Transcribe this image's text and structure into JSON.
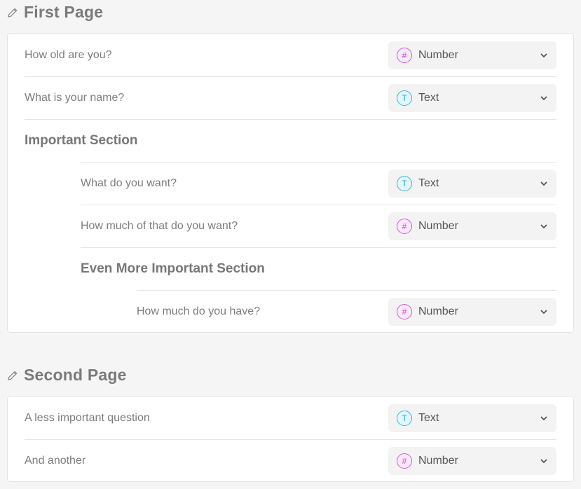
{
  "pages": [
    {
      "title": "First Page",
      "rows": [
        {
          "question": "How old are you?",
          "type": "Number",
          "icon": "number-icon",
          "glyph": "#"
        },
        {
          "question": "What is your name?",
          "type": "Text",
          "icon": "text-icon",
          "glyph": "T"
        }
      ],
      "section": {
        "title": "Important Section",
        "rows": [
          {
            "question": "What do you want?",
            "type": "Text",
            "icon": "text-icon",
            "glyph": "T"
          },
          {
            "question": "How much of that do you want?",
            "type": "Number",
            "icon": "number-icon",
            "glyph": "#"
          }
        ],
        "subsection": {
          "title": "Even More Important Section",
          "rows": [
            {
              "question": "How much do you have?",
              "type": "Number",
              "icon": "number-icon",
              "glyph": "#"
            }
          ]
        }
      }
    },
    {
      "title": "Second Page",
      "rows": [
        {
          "question": "A less important question",
          "type": "Text",
          "icon": "text-icon",
          "glyph": "T"
        },
        {
          "question": "And another",
          "type": "Number",
          "icon": "number-icon",
          "glyph": "#"
        }
      ]
    }
  ],
  "colors": {
    "number_accent": "#c44ccb",
    "text_accent": "#2aa6c6",
    "background": "#f5f5f5"
  }
}
